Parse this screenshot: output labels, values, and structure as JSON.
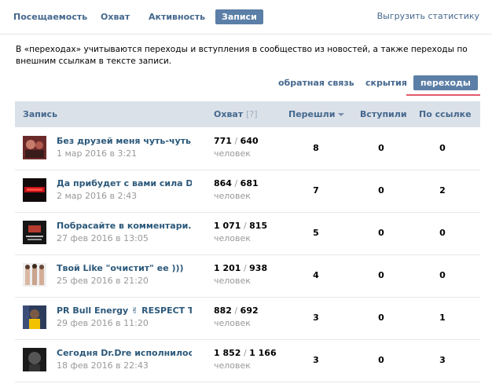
{
  "nav": {
    "tabs": [
      "Посещаемость",
      "Охват",
      "Активность",
      "Записи"
    ],
    "export": "Выгрузить статистику"
  },
  "info": "В «переходах» учитываются переходы и вступления в сообщество из новостей, а также переходы по внешним ссылкам в тексте записи.",
  "subtabs": [
    "обратная связь",
    "скрытия",
    "переходы"
  ],
  "table": {
    "headers": {
      "post": "Запись",
      "reach": "Охват",
      "reach_q": "[?]",
      "clicks": "Перешли",
      "joined": "Вступили",
      "link": "По ссылке"
    },
    "rows": [
      {
        "title": "Без друзей меня чуть-чуть,...",
        "date": "1 мар 2016 в 3:21",
        "reach_a": "771",
        "reach_b": "640",
        "people": "человек",
        "clicks": "8",
        "joined": "0",
        "link": "0"
      },
      {
        "title": "Да прибудет с вами сила D...",
        "date": "2 мар 2016 в 2:43",
        "reach_a": "864",
        "reach_b": "681",
        "people": "человек",
        "clicks": "7",
        "joined": "0",
        "link": "2"
      },
      {
        "title": "Побрасайте в комментари...",
        "date": "27 фев 2016 в 13:05",
        "reach_a": "1 071",
        "reach_b": "815",
        "people": "человек",
        "clicks": "5",
        "joined": "0",
        "link": "0"
      },
      {
        "title": "Твой Like \"очистит\" ее )))",
        "date": "25 фев 2016 в 21:20",
        "reach_a": "1 201",
        "reach_b": "938",
        "people": "человек",
        "clicks": "4",
        "joined": "0",
        "link": "0"
      },
      {
        "title": "PR Bull Energy ✌ RESPECT T...",
        "date": "29 фев 2016 в 11:20",
        "reach_a": "882",
        "reach_b": "692",
        "people": "человек",
        "clicks": "3",
        "joined": "0",
        "link": "1"
      },
      {
        "title": "Сегодня Dr.Dre исполнилос...",
        "date": "18 фев 2016 в 22:43",
        "reach_a": "1 852",
        "reach_b": "1 166",
        "people": "человек",
        "clicks": "3",
        "joined": "0",
        "link": "3"
      }
    ]
  },
  "colors": {
    "accent": "#5b7fa6",
    "link": "#45688e",
    "header_bg": "#dae1e8",
    "underline": "#e05a6b"
  }
}
